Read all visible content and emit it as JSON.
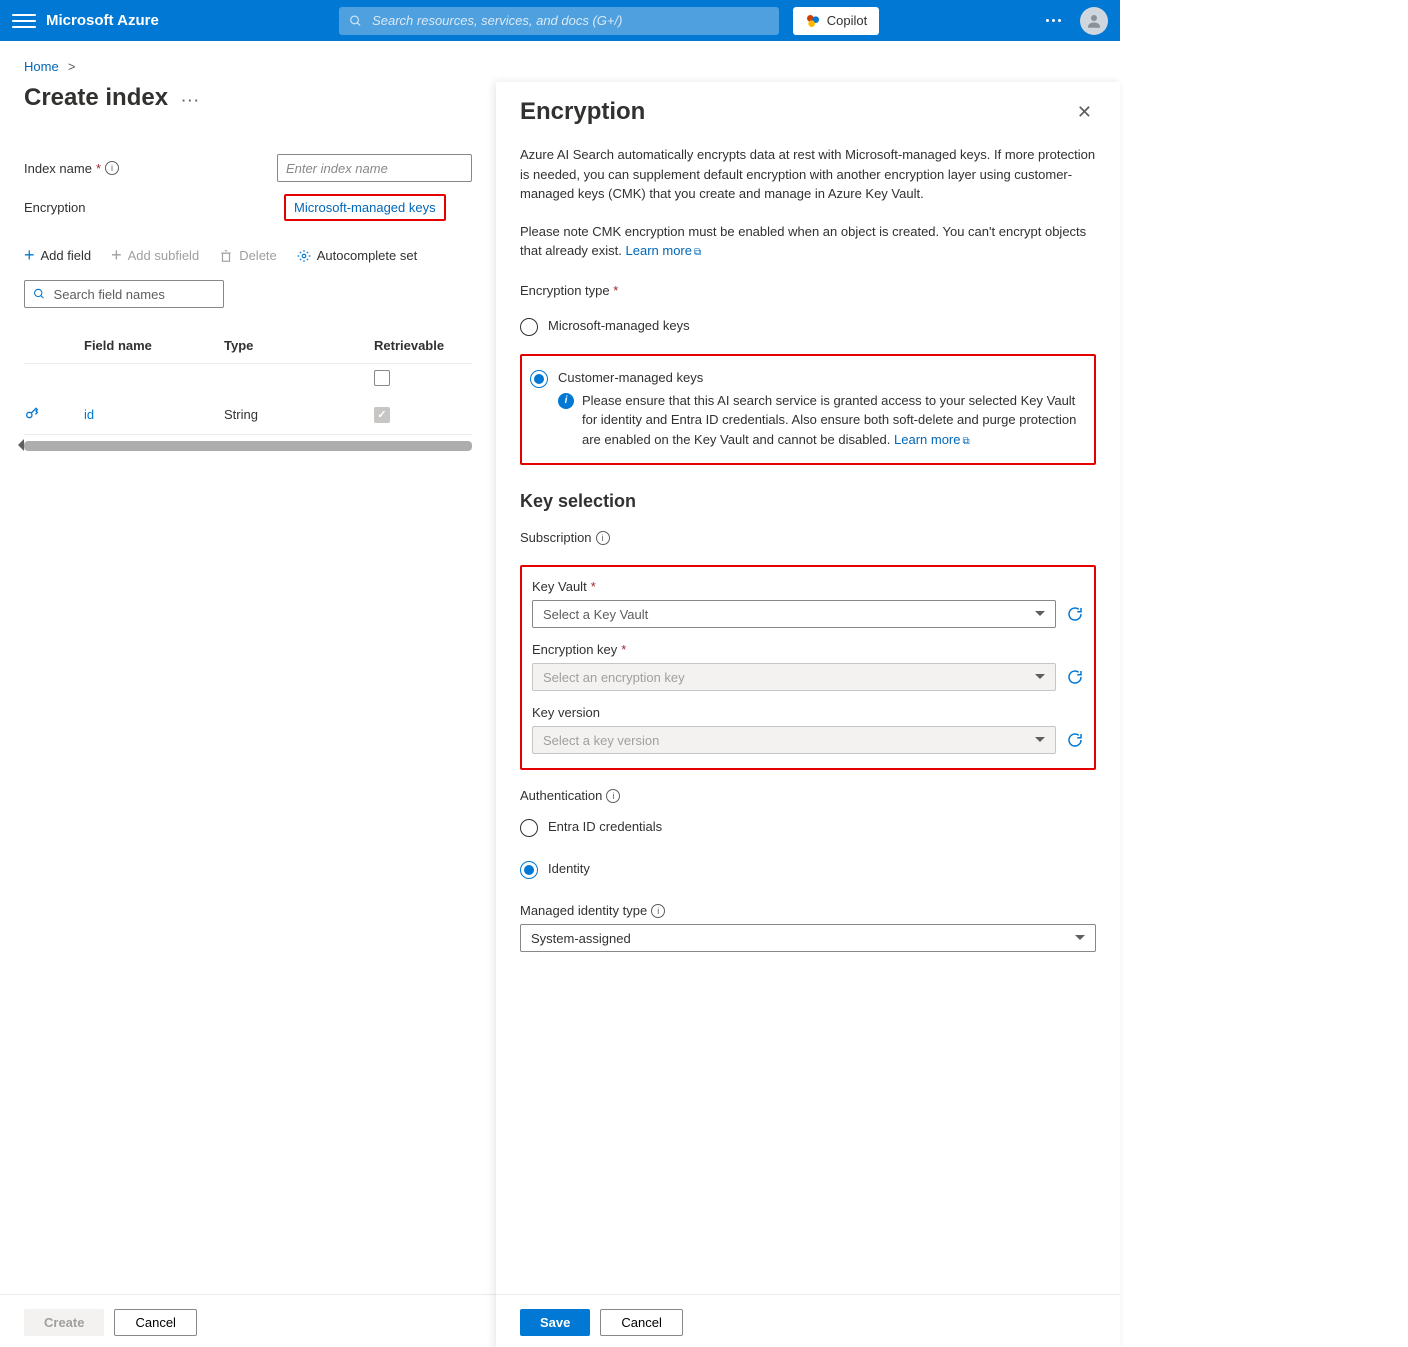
{
  "topbar": {
    "brand": "Microsoft Azure",
    "search_placeholder": "Search resources, services, and docs (G+/)",
    "copilot": "Copilot"
  },
  "breadcrumb": {
    "home": "Home"
  },
  "page": {
    "title": "Create index",
    "index_name_label": "Index name",
    "index_name_placeholder": "Enter index name",
    "encryption_label": "Encryption",
    "encryption_link": "Microsoft-managed keys"
  },
  "toolbar": {
    "add_field": "Add field",
    "add_subfield": "Add subfield",
    "delete": "Delete",
    "autocomplete": "Autocomplete set"
  },
  "field_search_placeholder": "Search field names",
  "fields_table": {
    "columns": {
      "field_name": "Field name",
      "type": "Type",
      "retrievable": "Retrievable"
    },
    "rows": [
      {
        "key": true,
        "name": "id",
        "type": "String",
        "retrievable": true
      }
    ]
  },
  "bottom": {
    "create": "Create",
    "cancel": "Cancel"
  },
  "panel": {
    "title": "Encryption",
    "desc1": "Azure AI Search automatically encrypts data at rest with Microsoft-managed keys. If more protection is needed, you can supplement default encryption with another encryption layer using customer-managed keys (CMK) that you create and manage in Azure Key Vault.",
    "desc2": "Please note CMK encryption must be enabled when an object is created. You can't encrypt objects that already exist.",
    "learn_more": "Learn more",
    "enc_type_label": "Encryption type",
    "option_ms": "Microsoft-managed keys",
    "option_cust": "Customer-managed keys",
    "cust_info": "Please ensure that this AI search service is granted access to your selected Key Vault for identity and Entra ID credentials. Also ensure both soft-delete and purge protection are enabled on the Key Vault and cannot be disabled.",
    "key_selection_title": "Key selection",
    "subscription_label": "Subscription",
    "key_vault_label": "Key Vault",
    "key_vault_placeholder": "Select a Key Vault",
    "enc_key_label": "Encryption key",
    "enc_key_placeholder": "Select an encryption key",
    "key_version_label": "Key version",
    "key_version_placeholder": "Select a key version",
    "auth_label": "Authentication",
    "auth_entra": "Entra ID credentials",
    "auth_identity": "Identity",
    "managed_identity_label": "Managed identity type",
    "managed_identity_value": "System-assigned",
    "save": "Save",
    "cancel": "Cancel"
  }
}
